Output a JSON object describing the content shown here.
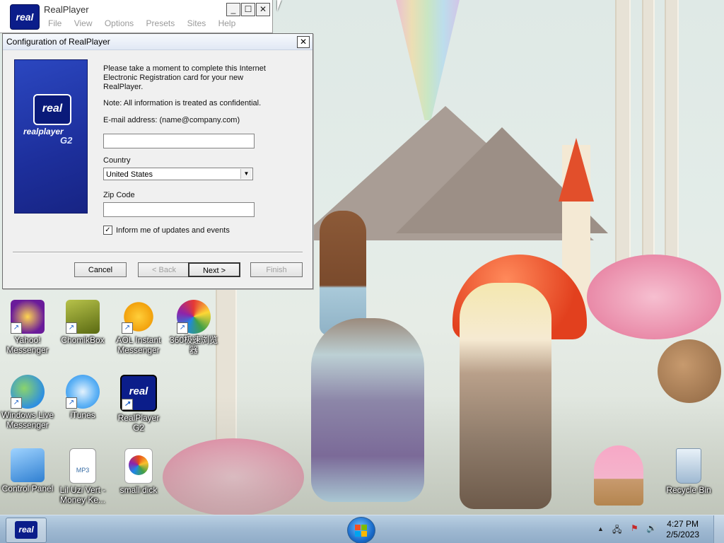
{
  "realplayer_window": {
    "title": "RealPlayer",
    "logo_text": "real",
    "menu": [
      "File",
      "View",
      "Options",
      "Presets",
      "Sites",
      "Help"
    ],
    "controls": {
      "minimize": "_",
      "maximize": "☐",
      "close": "✕"
    }
  },
  "dialog": {
    "title": "Configuration of RealPlayer",
    "close": "✕",
    "brand": {
      "logo_text": "real",
      "wordmark": "realplayer",
      "version": "G2"
    },
    "intro": "Please take a moment to complete this Internet Electronic Registration card for your new RealPlayer.",
    "note": "Note: All information is treated as confidential.",
    "email_label": "E-mail address: (name@company.com)",
    "email_value": "",
    "country_label": "Country",
    "country_value": "United States",
    "zip_label": "Zip Code",
    "zip_value": "",
    "checkbox_label": "Inform me of updates and events",
    "checkbox_checked": true,
    "buttons": {
      "cancel": "Cancel",
      "back": "< Back",
      "next": "Next >",
      "finish": "Finish"
    }
  },
  "desktop_icons": [
    {
      "label": "Yahoo! Messenger",
      "icon": "yahoo-messenger-icon",
      "color": "#6a1b9a"
    },
    {
      "label": "ChomikBox",
      "icon": "chomikbox-icon",
      "color": "#7a8a1e"
    },
    {
      "label": "AOL Instant Messenger",
      "icon": "aim-icon",
      "color": "#f2a10c"
    },
    {
      "label": "360极速浏览器",
      "icon": "browser-360-icon",
      "color": "#e53935"
    },
    {
      "label": "Windows Live Messenger",
      "icon": "windows-live-messenger-icon",
      "color": "#2e8fe0"
    },
    {
      "label": "iTunes",
      "icon": "itunes-icon",
      "color": "#1e88e5"
    },
    {
      "label": "RealPlayer G2",
      "icon": "realplayer-icon",
      "color": "#0b1d8a"
    },
    {
      "label": "Control Panel",
      "icon": "control-panel-icon",
      "color": "#2f7fd1"
    },
    {
      "label": "Lil Uzi Vert - Money Ke...",
      "icon": "mp3-file-icon",
      "color": "#3a6ea5"
    },
    {
      "label": "small dick",
      "icon": "image-file-icon",
      "color": "#e64a19"
    },
    {
      "label": "Recycle Bin",
      "icon": "recycle-bin-icon",
      "color": "#9fb9d2"
    }
  ],
  "taskbar": {
    "app_logo_text": "real",
    "tray": {
      "up_arrow": "▲",
      "network": "🖧",
      "flag": "⚑",
      "volume": "🔊"
    },
    "time": "4:27 PM",
    "date": "2/5/2023"
  }
}
